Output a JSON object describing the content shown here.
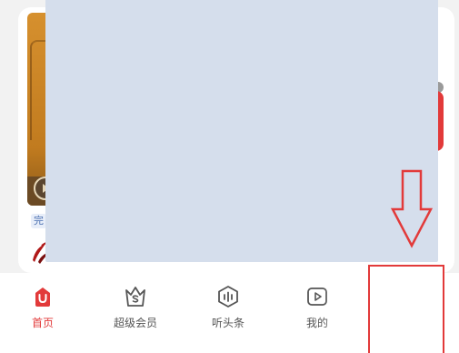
{
  "content": {
    "status_tag": "完",
    "cover_icon": "play-circle-icon"
  },
  "bottom_nav": {
    "items": [
      {
        "label": "首页",
        "icon": "home-icon",
        "active": true
      },
      {
        "label": "超级会员",
        "icon": "crown-s-icon",
        "active": false
      },
      {
        "label": "听头条",
        "icon": "sound-wave-icon",
        "active": false
      },
      {
        "label": "我的",
        "icon": "play-square-icon",
        "active": false
      }
    ]
  },
  "colors": {
    "accent": "#e23a3a",
    "overlay": "#d5deec",
    "nav_text": "#555555",
    "tag_text": "#4a6fb0"
  }
}
